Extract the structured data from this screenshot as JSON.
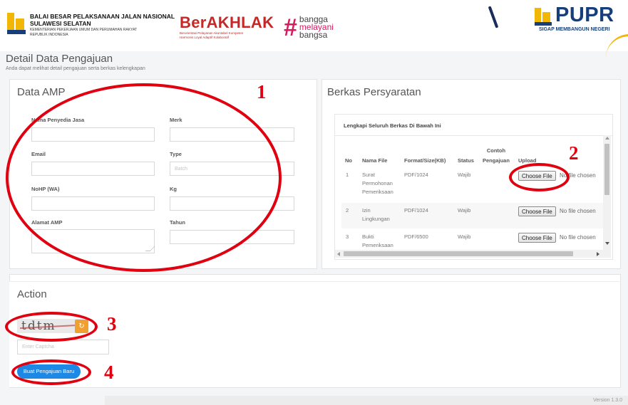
{
  "header": {
    "org_line1": "BALAI BESAR PELAKSANAAN JALAN NASIONAL",
    "org_line2": "SULAWESI SELATAN",
    "org_line3": "KEMENTERIAN PEKERJAAN UMUM DAN PERUMAHAN RAKYAT",
    "org_line4": "REPUBLIK INDONESIA",
    "berakhlak": "BerAKHLAK",
    "berakhlak_sub1": "Berorientasi Pelayanan Akuntabel Kompeten",
    "berakhlak_sub2": "Harmonis Loyal Adaptif Kolaboratif",
    "bangga_hash": "#",
    "bangga_l1": "bangga",
    "bangga_l2": "melayani",
    "bangga_l3": "bangsa",
    "pupr": "PUPR",
    "pupr_tag": "SIGAP MEMBANGUN NEGERI"
  },
  "page": {
    "title": "Detail Data Pengajuan",
    "subtitle": "Anda dapat melihat detail pengajuan serta berkas kelengkapan"
  },
  "amp": {
    "title": "Data AMP",
    "fields": {
      "nama_label": "Nama Penyedia Jasa",
      "merk_label": "Merk",
      "email_label": "Email",
      "type_label": "Type",
      "type_placeholder": "Batch",
      "nohp_label": "NoHP (WA)",
      "kg_label": "Kg",
      "alamat_label": "Alamat AMP",
      "tahun_label": "Tahun"
    }
  },
  "berkas": {
    "title": "Berkas Persyaratan",
    "box_title": "Lengkapi Seluruh Berkas Di Bawah Ini",
    "columns": {
      "no": "No",
      "nama_file": "Nama File",
      "format": "Format/Size(KB)",
      "status": "Status",
      "contoh_l1": "Contoh",
      "contoh_l2": "Pengajuan",
      "upload": "Upload"
    },
    "rows": [
      {
        "no": "1",
        "nama_l1": "Surat",
        "nama_l2": "Permohonan",
        "nama_l3": "Pemeriksaan",
        "format": "PDF/1024",
        "status": "Wajib"
      },
      {
        "no": "2",
        "nama_l1": "Izin",
        "nama_l2": "Lingkungan",
        "nama_l3": "",
        "format": "PDF/1024",
        "status": "Wajib"
      },
      {
        "no": "3",
        "nama_l1": "Bukti",
        "nama_l2": "Pemeriksaan",
        "nama_l3": "",
        "format": "PDF/6500",
        "status": "Wajib"
      }
    ],
    "choose_file": "Choose File",
    "no_file": "No file chosen"
  },
  "action": {
    "title": "Action",
    "captcha_text": "tdtm",
    "refresh_icon": "↻",
    "captcha_placeholder": "Enter Captcha",
    "submit_label": "Buat Pengajuan Baru"
  },
  "annotations": {
    "n1": "1",
    "n2": "2",
    "n3": "3",
    "n4": "4",
    "color": "#e0000f"
  },
  "footer": {
    "version": "Version 1.3.0"
  }
}
